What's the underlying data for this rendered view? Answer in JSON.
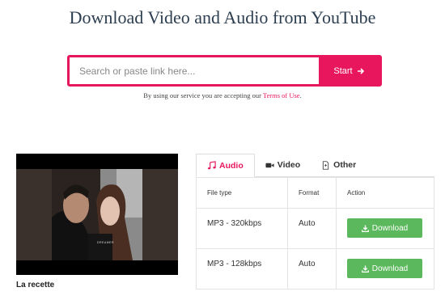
{
  "page": {
    "title": "Download Video and Audio from YouTube"
  },
  "search": {
    "placeholder": "Search or paste link here...",
    "value": "",
    "button_label": "Start"
  },
  "terms": {
    "prefix": "By using our service you are accepting our ",
    "link_text": "Terms of Use",
    "suffix": "."
  },
  "video": {
    "title": "La recette"
  },
  "tabs": [
    {
      "label": "Audio",
      "icon": "music-icon",
      "active": true
    },
    {
      "label": "Video",
      "icon": "video-camera-icon",
      "active": false
    },
    {
      "label": "Other",
      "icon": "file-icon",
      "active": false
    }
  ],
  "table": {
    "headers": [
      "File type",
      "Format",
      "Action"
    ],
    "rows": [
      {
        "file_type": "MP3 - 320kbps",
        "format": "Auto",
        "action": "Download"
      },
      {
        "file_type": "MP3 - 128kbps",
        "format": "Auto",
        "action": "Download"
      }
    ]
  },
  "colors": {
    "accent": "#e8175d",
    "download": "#5cb85c",
    "heading": "#2c3e50"
  }
}
